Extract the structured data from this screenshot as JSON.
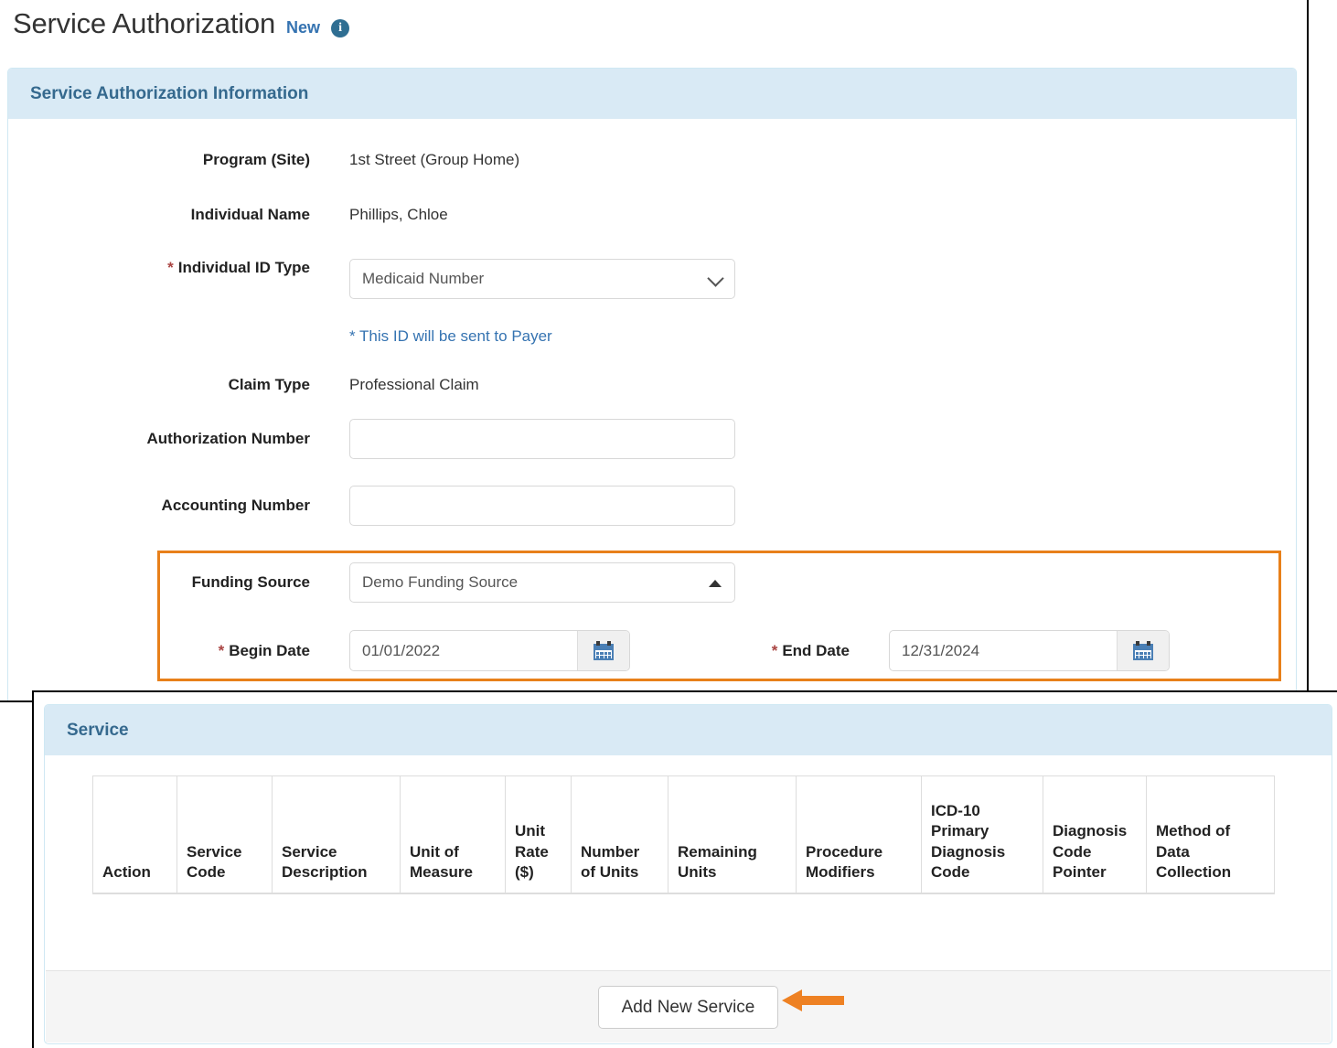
{
  "page": {
    "title": "Service Authorization",
    "status": "New",
    "info_icon": "info-icon"
  },
  "auth_panel": {
    "header": "Service Authorization Information",
    "fields": {
      "program_site": {
        "label": "Program (Site)",
        "value": "1st Street (Group Home)"
      },
      "individual_name": {
        "label": "Individual Name",
        "value": "Phillips, Chloe"
      },
      "individual_id_type": {
        "label": "Individual ID Type",
        "required_marker": "*",
        "value": "Medicaid Number",
        "options": [
          "Medicaid Number"
        ],
        "hint": "* This ID will be sent to Payer",
        "chevron_icon": "chevron-down-icon"
      },
      "claim_type": {
        "label": "Claim Type",
        "value": "Professional Claim"
      },
      "authorization_number": {
        "label": "Authorization Number",
        "value": "",
        "placeholder": ""
      },
      "accounting_number": {
        "label": "Accounting Number",
        "value": "",
        "placeholder": ""
      },
      "funding_source": {
        "label": "Funding Source",
        "value": "Demo Funding Source",
        "options": [
          "Demo Funding Source"
        ],
        "chevron_icon": "triangle-up-icon"
      },
      "begin_date": {
        "label": "Begin Date",
        "required_marker": "*",
        "value": "01/01/2022",
        "placeholder": "",
        "calendar_icon": "calendar-icon"
      },
      "end_date": {
        "label": "End Date",
        "required_marker": "*",
        "value": "12/31/2024",
        "placeholder": "",
        "calendar_icon": "calendar-icon"
      }
    },
    "highlight_color": "#e8801a"
  },
  "service_panel": {
    "header": "Service",
    "columns": [
      "Action",
      "Service Code",
      "Service Description",
      "Unit of Measure",
      "Unit Rate ($)",
      "Number of Units",
      "Remaining Units",
      "Procedure Modifiers",
      "ICD-10 Primary Diagnosis Code",
      "Diagnosis Code Pointer",
      "Method of Data Collection"
    ],
    "column_lines": [
      [
        "Action"
      ],
      [
        "Service",
        "Code"
      ],
      [
        "Service",
        "Description"
      ],
      [
        "Unit of",
        "Measure"
      ],
      [
        "Unit",
        "Rate",
        "($)"
      ],
      [
        "Number",
        "of Units"
      ],
      [
        "Remaining",
        "Units"
      ],
      [
        "Procedure",
        "Modifiers"
      ],
      [
        "ICD-10",
        "Primary",
        "Diagnosis",
        "Code"
      ],
      [
        "Diagnosis",
        "Code",
        "Pointer"
      ],
      [
        "Method of",
        "Data",
        "Collection"
      ]
    ],
    "rows": [],
    "add_button": "Add New Service",
    "annotation_arrow": "left-arrow-annotation",
    "annotation_color": "#ee8123"
  },
  "theme": {
    "panel_header_bg": "#d9eaf5",
    "panel_header_text": "#35698e",
    "link_blue": "#3573b1",
    "required_red": "#a94442",
    "highlight_orange": "#e8801a"
  }
}
